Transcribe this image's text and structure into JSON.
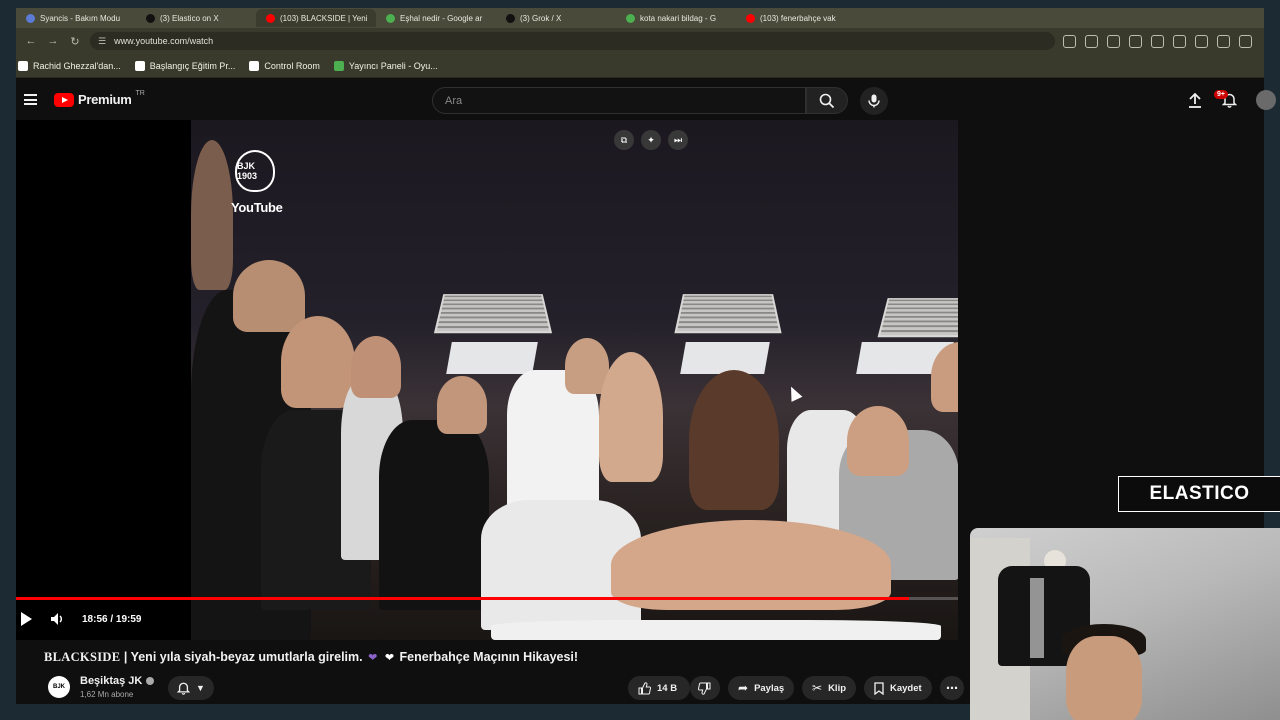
{
  "browser": {
    "tabs": [
      {
        "label": "Syancis - Bakım Modu",
        "color": "#5b7bd5",
        "active": false
      },
      {
        "label": "(3) Elastico on X",
        "color": "#111111",
        "active": false
      },
      {
        "label": "(103) BLACKSIDE | Yeni",
        "color": "#ff0000",
        "active": true
      },
      {
        "label": "Eşhal nedir - Google ar",
        "color": "#4caf50",
        "active": false
      },
      {
        "label": "(3) Grok / X",
        "color": "#111111",
        "active": false
      },
      {
        "label": "kota nakari bildag - G",
        "color": "#4caf50",
        "active": false
      },
      {
        "label": "(103) fenerbahçe vak",
        "color": "#ff0000",
        "active": false
      }
    ],
    "url": "www.youtube.com/watch",
    "bookmarks": [
      {
        "label": "Rachid Ghezzal'dan...",
        "color": "#ffffff"
      },
      {
        "label": "Başlangıç Eğitim Pr...",
        "color": "#ffffff"
      },
      {
        "label": "Control Room",
        "color": "#ffffff"
      },
      {
        "label": "Yayıncı Paneli - Oyu...",
        "color": "#4caf50"
      }
    ]
  },
  "youtube": {
    "brand": "Premium",
    "country": "TR",
    "search_placeholder": "Ara",
    "notification_badge": "9+"
  },
  "player": {
    "watermark": "YouTube",
    "crest_text": "BJK 1903",
    "time_current": "18:56",
    "time_total": "19:59",
    "time_display": "18:56 / 19:59",
    "progress": 0.948
  },
  "video": {
    "title_brand": "BLACKSIDE",
    "title_separator": "|",
    "title_main": "Yeni yıla siyah-beyaz umutlarla girelim.",
    "title_tail": "Fenerbahçe Maçının Hikayesi!",
    "channel_name": "Beşiktaş JK",
    "channel_subs": "1,62 Mn abone",
    "likes": "14 B",
    "share_label": "Paylaş",
    "clip_label": "Klip",
    "save_label": "Kaydet"
  },
  "overlay": {
    "elastico_label": "ELASTICO"
  }
}
